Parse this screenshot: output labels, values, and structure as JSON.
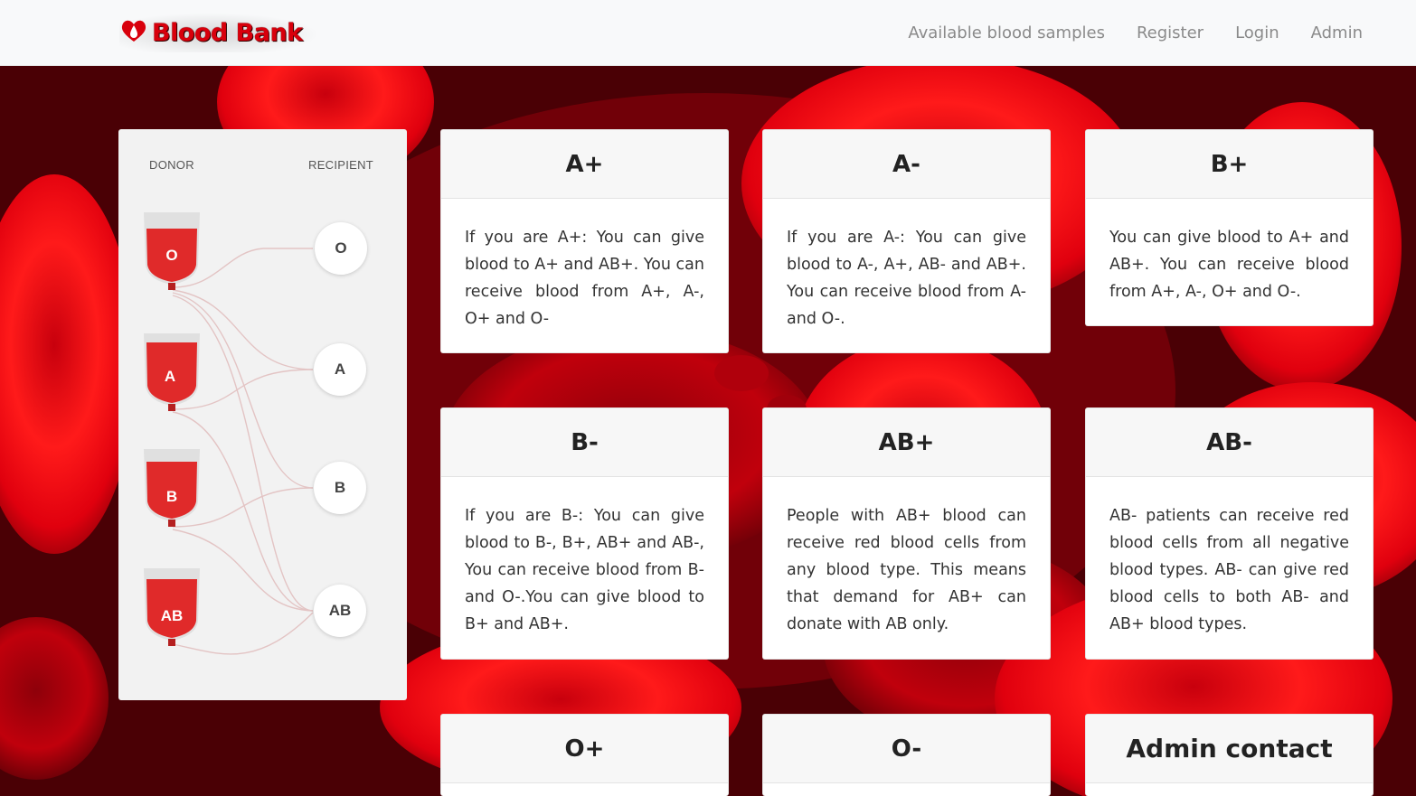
{
  "brand": {
    "name": "Blood Bank",
    "icon": "blood-drop-heart-icon",
    "color": "#d8000c"
  },
  "nav": {
    "items": [
      {
        "label": "Available blood samples"
      },
      {
        "label": "Register"
      },
      {
        "label": "Login"
      },
      {
        "label": "Admin"
      }
    ]
  },
  "compat": {
    "donor_heading": "DONOR",
    "recipient_heading": "RECIPIENT",
    "donors": [
      "O",
      "A",
      "B",
      "AB"
    ],
    "recipients": [
      "O",
      "A",
      "B",
      "AB"
    ]
  },
  "cards": [
    {
      "title": "A+",
      "text": "If you are A+: You can give blood to A+ and AB+. You can receive blood from A+, A-, O+ and O-"
    },
    {
      "title": "A-",
      "text": "If you are A-: You can give blood to A-, A+, AB- and AB+. You can receive blood from A- and O-."
    },
    {
      "title": "B+",
      "text": "You can give blood to A+ and AB+. You can receive blood from A+, A-, O+ and O-."
    },
    {
      "title": "B-",
      "text": "If you are B-: You can give blood to B-, B+, AB+ and AB-, You can receive blood from B- and O-.You can give blood to B+ and AB+."
    },
    {
      "title": "AB+",
      "text": "People with AB+ blood can receive red blood cells from any blood type. This means that demand for AB+ can donate with AB only."
    },
    {
      "title": "AB-",
      "text": "AB- patients can receive red blood cells from all negative blood types. AB- can give red blood cells to both AB- and AB+ blood types."
    },
    {
      "title": "O+",
      "text": ""
    },
    {
      "title": "O-",
      "text": ""
    },
    {
      "title": "Admin contact",
      "text": ""
    }
  ]
}
